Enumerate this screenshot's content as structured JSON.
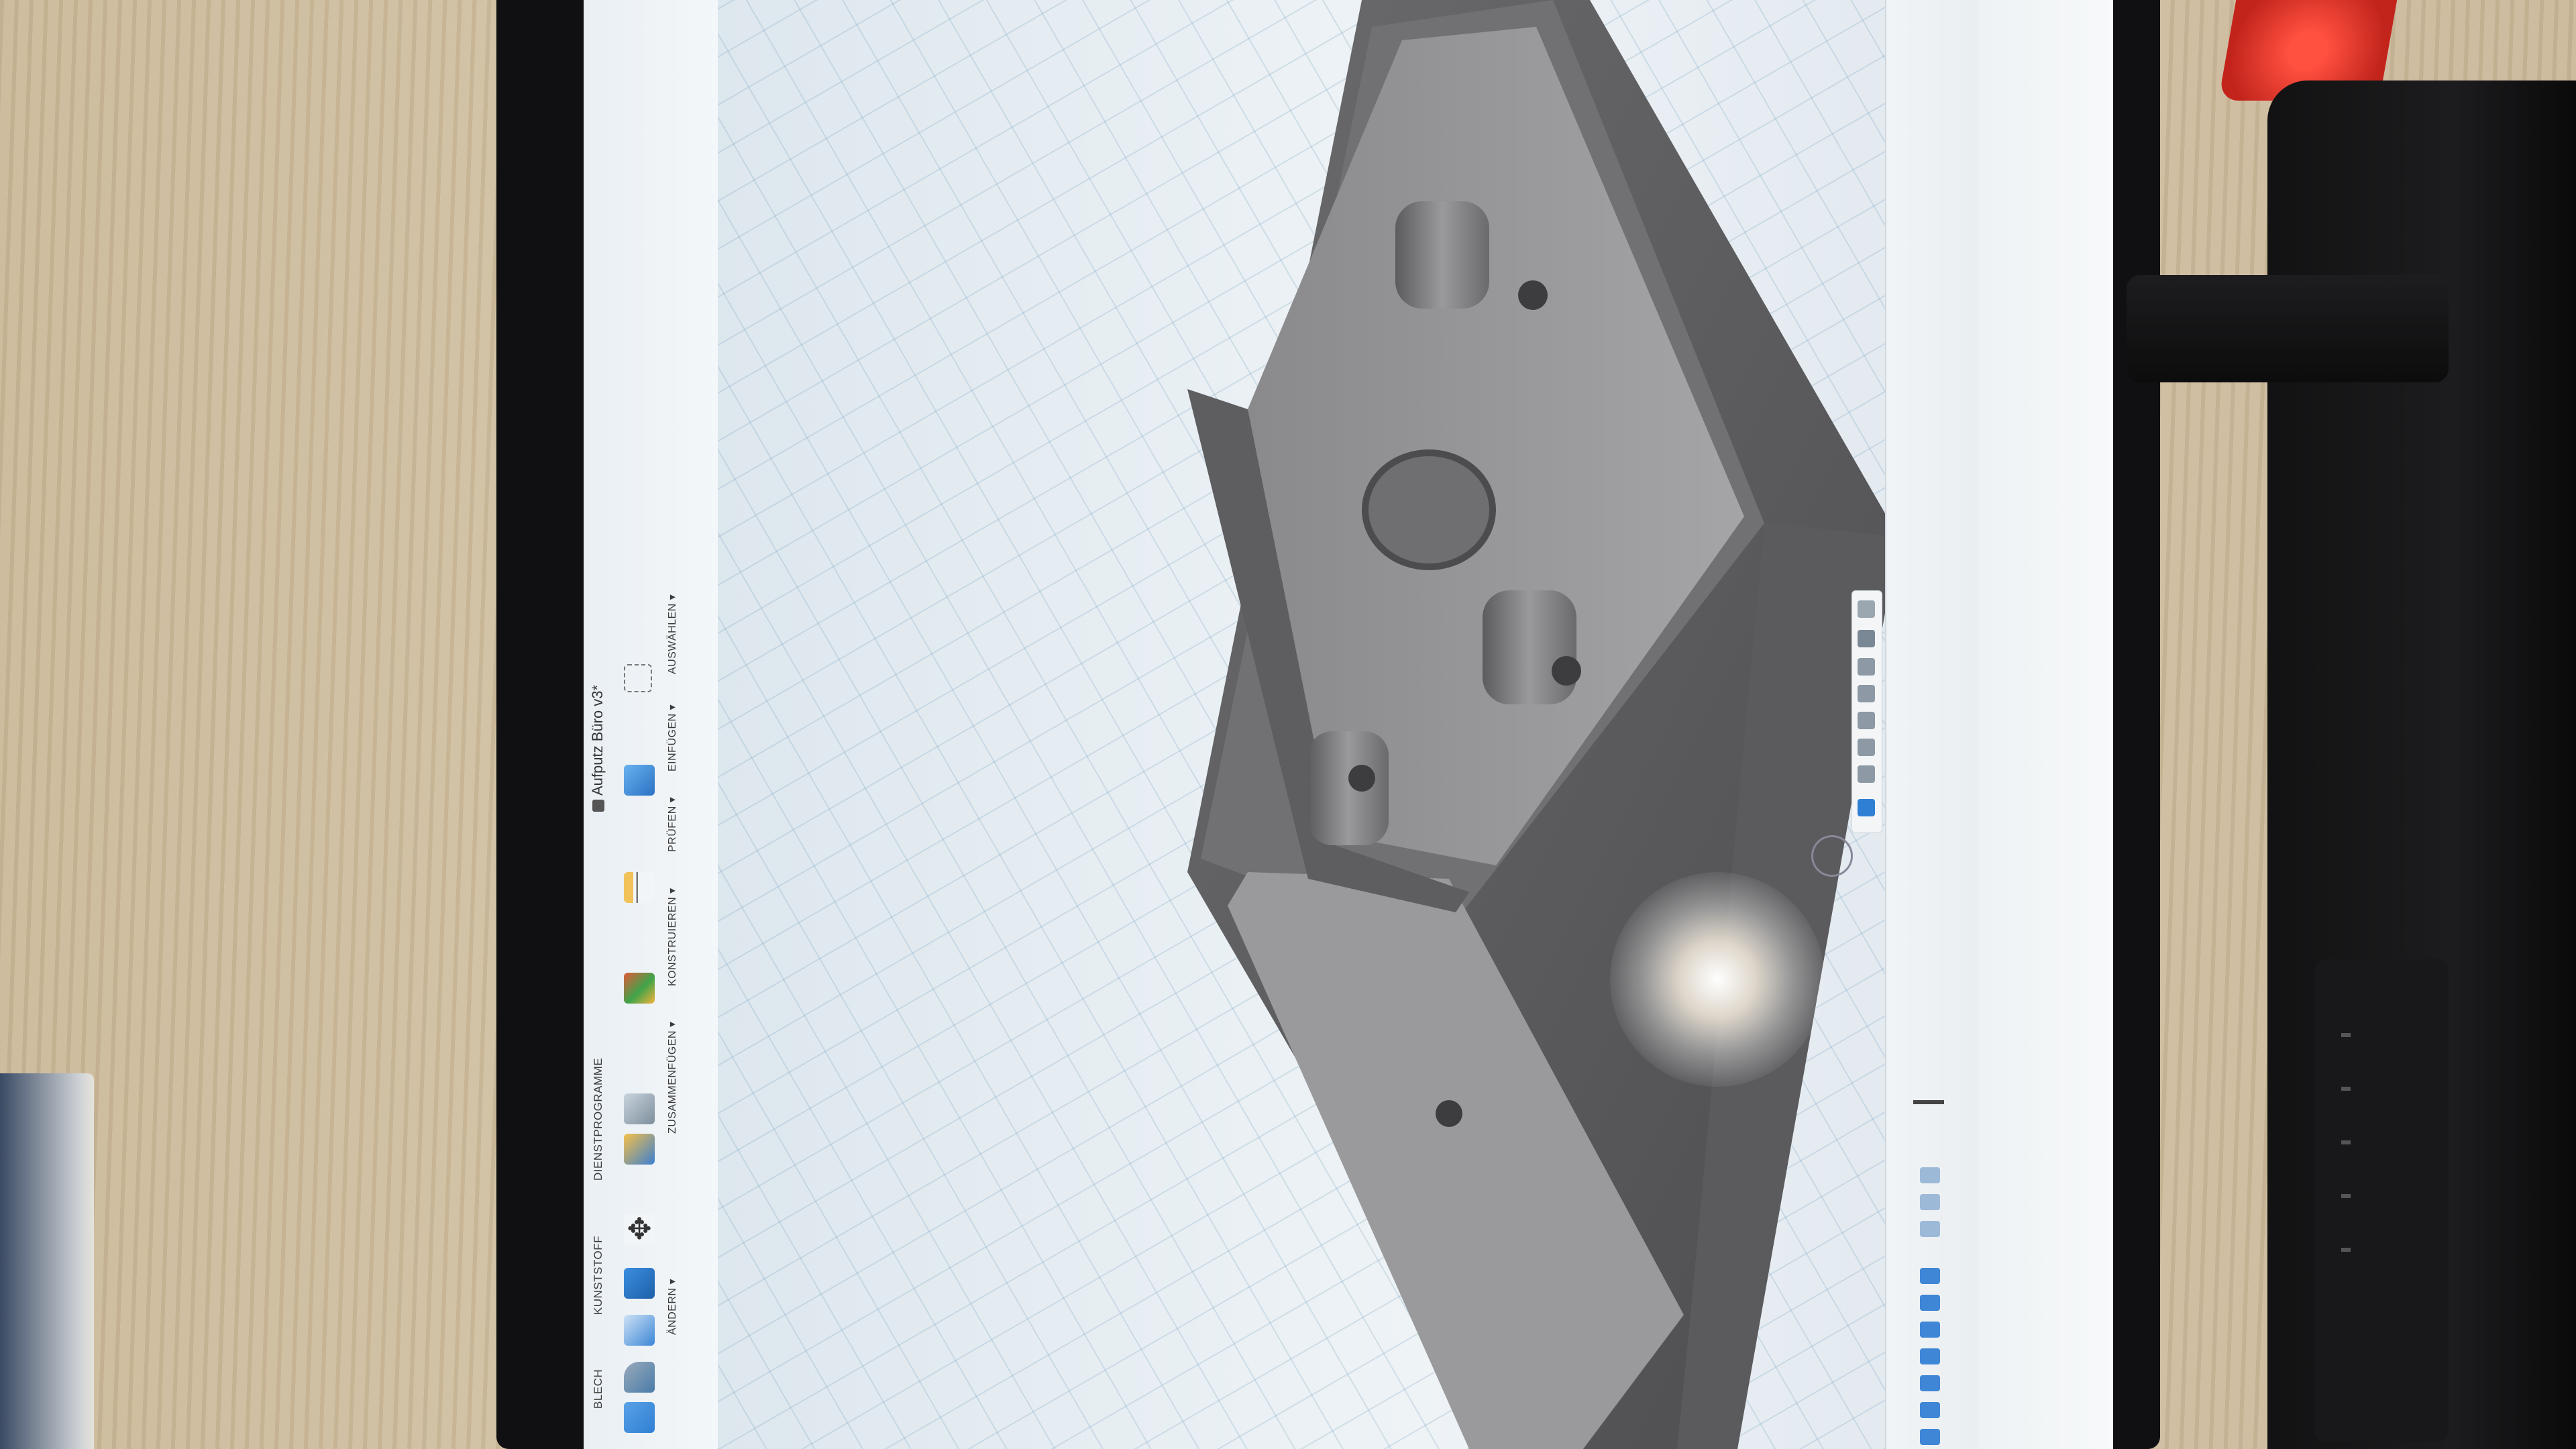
{
  "app": {
    "document_title": "Aufputz Büro v3*"
  },
  "ribbon": {
    "tabs": [
      {
        "id": "blech",
        "label": "BLECH"
      },
      {
        "id": "kunststoff",
        "label": "KUNSTSTOFF"
      },
      {
        "id": "dienstprogramme",
        "label": "DIENSTPROGRAMME"
      }
    ],
    "groups": [
      {
        "id": "aendern",
        "label": "ÄNDERN ▾"
      },
      {
        "id": "zusammenfuegen",
        "label": "ZUSAMMENFÜGEN ▾"
      },
      {
        "id": "konstruieren",
        "label": "KONSTRUIEREN ▾"
      },
      {
        "id": "pruefen",
        "label": "PRÜFEN ▾"
      },
      {
        "id": "einfuegen",
        "label": "EINFÜGEN ▾"
      },
      {
        "id": "auswaehlen",
        "label": "AUSWÄHLEN ▾"
      }
    ],
    "icons": {
      "blech-icon": "sheet-metal",
      "press-pull-icon": "press-pull",
      "fillet-icon": "fillet",
      "combine-icon": "combine",
      "move-icon": "move",
      "joint-icon": "joint",
      "as-built-joint-icon": "as-built-joint",
      "plane-icon": "offset-plane",
      "measure-icon": "measure",
      "insert-image-icon": "insert-image",
      "select-icon": "select"
    }
  },
  "colors": {
    "ribbon_bg": "#f2f5f8",
    "viewport_bg": "#e6edf2",
    "grid": "#9fb9cc",
    "model": "#5a5a5c",
    "accent": "#2f7fd4"
  },
  "navbar": {
    "buttons": [
      "orbit",
      "look-at",
      "pan",
      "zoom",
      "fit",
      "display-settings",
      "grid-settings",
      "viewports"
    ]
  }
}
